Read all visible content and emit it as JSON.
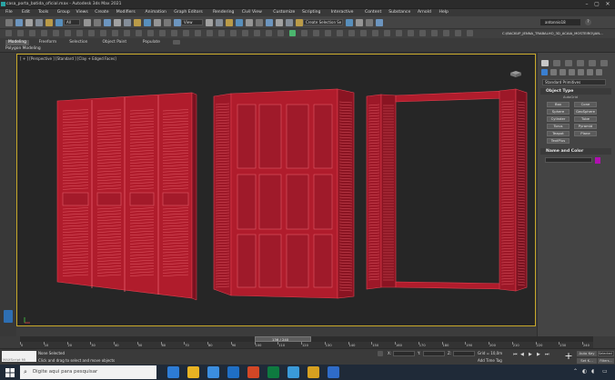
{
  "window": {
    "title": "casa_porta_batida_oficial.max - Autodesk 3ds Max 2021",
    "user": "antonnio18"
  },
  "menu": [
    "File",
    "Edit",
    "Tools",
    "Group",
    "Views",
    "Create",
    "Modifiers",
    "Animation",
    "Graph Editors",
    "Rendering",
    "Civil View",
    "Customize",
    "Scripting",
    "Interactive",
    "Content",
    "Substance",
    "Arnold",
    "Help"
  ],
  "toolbar": {
    "filter_value": "All",
    "view_value": "View",
    "selection_set_placeholder": "Create Selection Se",
    "workspace_path": "C:\\BACKUP_JENNA_TRABALHO_3D_ACAIA_MOSTEIRO\\JAN...",
    "icon_names": [
      "undo-icon",
      "redo-icon",
      "link-icon",
      "unlink-icon",
      "bind-icon",
      "select-icon",
      "select-name-icon",
      "rect-select-icon",
      "window-crossing-icon",
      "move-icon",
      "rotate-icon",
      "scale-icon",
      "place-icon",
      "pivot-icon",
      "snap-icon",
      "angle-snap-icon",
      "percent-snap-icon",
      "spinner-snap-icon",
      "edit-named-sets-icon",
      "mirror-icon",
      "align-icon",
      "layers-icon",
      "curve-editor-icon",
      "schematic-icon",
      "material-editor-icon",
      "render-setup-icon",
      "render-frame-icon",
      "render-icon",
      "arnold-icon",
      "teapot-icon"
    ]
  },
  "ribbon": {
    "tabs": [
      "Modeling",
      "Freeform",
      "Selection",
      "Object Paint",
      "Populate"
    ],
    "active_tab": "Modeling",
    "sub_label": "Polygon Modeling"
  },
  "viewport": {
    "label": "[ + ] [Perspective ] [Standard ] [Clay + Edged Faces]",
    "border_color": "#c8a82a",
    "wire_color": "#c1283a"
  },
  "command_panel": {
    "tab_icon_names": [
      "create-tab-icon",
      "modify-tab-icon",
      "hierarchy-tab-icon",
      "motion-tab-icon",
      "display-tab-icon",
      "utilities-tab-icon"
    ],
    "category_icon_names": [
      "geometry-icon",
      "shapes-icon",
      "lights-icon",
      "cameras-icon",
      "helpers-icon",
      "spacewarps-icon",
      "systems-icon"
    ],
    "dropdown": "Standard Primitives",
    "object_type_title": "Object Type",
    "autogrid": "AutoGrid",
    "buttons": [
      "Box",
      "Cone",
      "Sphere",
      "GeoSphere",
      "Cylinder",
      "Tube",
      "Torus",
      "Pyramid",
      "Teapot",
      "Plane",
      "TextPlus",
      ""
    ],
    "name_color_title": "Name and Color",
    "swatch_color": "#b010b0"
  },
  "timeline": {
    "frame_counter": "136 / 240",
    "ticks": [
      "0",
      "10",
      "20",
      "30",
      "40",
      "50",
      "60",
      "70",
      "80",
      "90",
      "100",
      "110",
      "120",
      "130",
      "140",
      "150",
      "160",
      "170",
      "180",
      "190",
      "200",
      "210",
      "220",
      "230",
      "240"
    ]
  },
  "status": {
    "maxscript_hint": "MAXScript Mi",
    "selection": "None Selected",
    "prompt": "Click and drag to select and move objects",
    "x_label": "X:",
    "y_label": "Y:",
    "z_label": "Z:",
    "grid": "Grid = 10,0m",
    "add_time_tag": "Add Time Tag",
    "autokey": "Auto Key",
    "selected": "Selected",
    "set_key": "Set K...",
    "filters": "Filters..."
  },
  "taskbar": {
    "search_placeholder": "Digite aqui para pesquisar",
    "app_colors": [
      "#2d7cd6",
      "#e8b323",
      "#3b8ee0",
      "#1f6fc5",
      "#d24726",
      "#0e7a3f",
      "#3a9ad9",
      "#d6a020",
      "#2f6cc9"
    ]
  }
}
